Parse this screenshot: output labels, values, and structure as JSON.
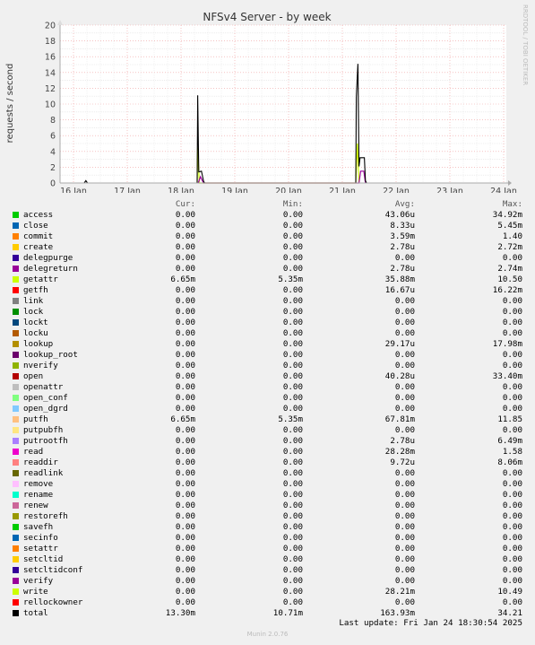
{
  "chart_data": {
    "type": "line",
    "title": "NFSv4 Server - by week",
    "ylabel": "requests / second",
    "watermark": "RRDTOOL / TOBI OETIKER",
    "ylim": [
      0,
      20
    ],
    "yticks": [
      "0",
      "2",
      "4",
      "6",
      "8",
      "10",
      "12",
      "14",
      "16",
      "18",
      "20"
    ],
    "xticks": [
      "16 Jan",
      "17 Jan",
      "18 Jan",
      "19 Jan",
      "20 Jan",
      "21 Jan",
      "22 Jan",
      "23 Jan",
      "24 Jan"
    ],
    "x_day_range": [
      15.75,
      24.05
    ],
    "series_total": {
      "name": "total",
      "points": [
        [
          16.2,
          0
        ],
        [
          16.23,
          0.3
        ],
        [
          16.26,
          0
        ],
        [
          18.3,
          0
        ],
        [
          18.31,
          11.1
        ],
        [
          18.33,
          1.4
        ],
        [
          18.38,
          1.5
        ],
        [
          18.42,
          0.2
        ],
        [
          18.44,
          0
        ],
        [
          21.25,
          0
        ],
        [
          21.26,
          10.9
        ],
        [
          21.29,
          15.1
        ],
        [
          21.31,
          2.1
        ],
        [
          21.33,
          3.2
        ],
        [
          21.41,
          3.2
        ],
        [
          21.43,
          0.3
        ],
        [
          21.45,
          0
        ]
      ]
    },
    "series_getattr": {
      "name": "getattr",
      "points": [
        [
          18.3,
          0
        ],
        [
          18.31,
          4.5
        ],
        [
          18.34,
          0
        ],
        [
          21.25,
          0
        ],
        [
          21.28,
          5.0
        ],
        [
          21.31,
          0
        ]
      ]
    },
    "series_putfh": {
      "name": "putfh",
      "points": [
        [
          18.32,
          0
        ],
        [
          18.36,
          0.8
        ],
        [
          18.42,
          0
        ],
        [
          21.31,
          0
        ],
        [
          21.34,
          1.5
        ],
        [
          21.4,
          1.5
        ],
        [
          21.43,
          0
        ]
      ]
    }
  },
  "legend": {
    "headers": {
      "cur": "Cur:",
      "min": "Min:",
      "avg": "Avg:",
      "max": "Max:"
    },
    "rows": [
      {
        "name": "access",
        "color": "#00cc00",
        "cur": "0.00",
        "min": "0.00",
        "avg": "43.06u",
        "max": "34.92m"
      },
      {
        "name": "close",
        "color": "#0066b3",
        "cur": "0.00",
        "min": "0.00",
        "avg": "8.33u",
        "max": "5.45m"
      },
      {
        "name": "commit",
        "color": "#ff8000",
        "cur": "0.00",
        "min": "0.00",
        "avg": "3.59m",
        "max": "1.40"
      },
      {
        "name": "create",
        "color": "#ffcc00",
        "cur": "0.00",
        "min": "0.00",
        "avg": "2.78u",
        "max": "2.72m"
      },
      {
        "name": "delegpurge",
        "color": "#330099",
        "cur": "0.00",
        "min": "0.00",
        "avg": "0.00",
        "max": "0.00"
      },
      {
        "name": "delegreturn",
        "color": "#990099",
        "cur": "0.00",
        "min": "0.00",
        "avg": "2.78u",
        "max": "2.74m"
      },
      {
        "name": "getattr",
        "color": "#ccff00",
        "cur": "6.65m",
        "min": "5.35m",
        "avg": "35.88m",
        "max": "10.50"
      },
      {
        "name": "getfh",
        "color": "#ff0000",
        "cur": "0.00",
        "min": "0.00",
        "avg": "16.67u",
        "max": "16.22m"
      },
      {
        "name": "link",
        "color": "#808080",
        "cur": "0.00",
        "min": "0.00",
        "avg": "0.00",
        "max": "0.00"
      },
      {
        "name": "lock",
        "color": "#008f00",
        "cur": "0.00",
        "min": "0.00",
        "avg": "0.00",
        "max": "0.00"
      },
      {
        "name": "lockt",
        "color": "#00487d",
        "cur": "0.00",
        "min": "0.00",
        "avg": "0.00",
        "max": "0.00"
      },
      {
        "name": "locku",
        "color": "#b35a00",
        "cur": "0.00",
        "min": "0.00",
        "avg": "0.00",
        "max": "0.00"
      },
      {
        "name": "lookup",
        "color": "#b38f00",
        "cur": "0.00",
        "min": "0.00",
        "avg": "29.17u",
        "max": "17.98m"
      },
      {
        "name": "lookup_root",
        "color": "#6b006b",
        "cur": "0.00",
        "min": "0.00",
        "avg": "0.00",
        "max": "0.00"
      },
      {
        "name": "nverify",
        "color": "#8fb300",
        "cur": "0.00",
        "min": "0.00",
        "avg": "0.00",
        "max": "0.00"
      },
      {
        "name": "open",
        "color": "#b30000",
        "cur": "0.00",
        "min": "0.00",
        "avg": "40.28u",
        "max": "33.40m"
      },
      {
        "name": "openattr",
        "color": "#bebebe",
        "cur": "0.00",
        "min": "0.00",
        "avg": "0.00",
        "max": "0.00"
      },
      {
        "name": "open_conf",
        "color": "#80ff80",
        "cur": "0.00",
        "min": "0.00",
        "avg": "0.00",
        "max": "0.00"
      },
      {
        "name": "open_dgrd",
        "color": "#80c9ff",
        "cur": "0.00",
        "min": "0.00",
        "avg": "0.00",
        "max": "0.00"
      },
      {
        "name": "putfh",
        "color": "#ffc080",
        "cur": "6.65m",
        "min": "5.35m",
        "avg": "67.81m",
        "max": "11.85"
      },
      {
        "name": "putpubfh",
        "color": "#ffe680",
        "cur": "0.00",
        "min": "0.00",
        "avg": "0.00",
        "max": "0.00"
      },
      {
        "name": "putrootfh",
        "color": "#aa80ff",
        "cur": "0.00",
        "min": "0.00",
        "avg": "2.78u",
        "max": "6.49m"
      },
      {
        "name": "read",
        "color": "#ee00cc",
        "cur": "0.00",
        "min": "0.00",
        "avg": "28.28m",
        "max": "1.58"
      },
      {
        "name": "readdir",
        "color": "#ff8080",
        "cur": "0.00",
        "min": "0.00",
        "avg": "9.72u",
        "max": "8.06m"
      },
      {
        "name": "readlink",
        "color": "#666600",
        "cur": "0.00",
        "min": "0.00",
        "avg": "0.00",
        "max": "0.00"
      },
      {
        "name": "remove",
        "color": "#ffbfff",
        "cur": "0.00",
        "min": "0.00",
        "avg": "0.00",
        "max": "0.00"
      },
      {
        "name": "rename",
        "color": "#00ffcc",
        "cur": "0.00",
        "min": "0.00",
        "avg": "0.00",
        "max": "0.00"
      },
      {
        "name": "renew",
        "color": "#cc6699",
        "cur": "0.00",
        "min": "0.00",
        "avg": "0.00",
        "max": "0.00"
      },
      {
        "name": "restorefh",
        "color": "#999900",
        "cur": "0.00",
        "min": "0.00",
        "avg": "0.00",
        "max": "0.00"
      },
      {
        "name": "savefh",
        "color": "#00cc00",
        "cur": "0.00",
        "min": "0.00",
        "avg": "0.00",
        "max": "0.00"
      },
      {
        "name": "secinfo",
        "color": "#0066b3",
        "cur": "0.00",
        "min": "0.00",
        "avg": "0.00",
        "max": "0.00"
      },
      {
        "name": "setattr",
        "color": "#ff8000",
        "cur": "0.00",
        "min": "0.00",
        "avg": "0.00",
        "max": "0.00"
      },
      {
        "name": "setcltid",
        "color": "#ffcc00",
        "cur": "0.00",
        "min": "0.00",
        "avg": "0.00",
        "max": "0.00"
      },
      {
        "name": "setcltidconf",
        "color": "#330099",
        "cur": "0.00",
        "min": "0.00",
        "avg": "0.00",
        "max": "0.00"
      },
      {
        "name": "verify",
        "color": "#990099",
        "cur": "0.00",
        "min": "0.00",
        "avg": "0.00",
        "max": "0.00"
      },
      {
        "name": "write",
        "color": "#ccff00",
        "cur": "0.00",
        "min": "0.00",
        "avg": "28.21m",
        "max": "10.49"
      },
      {
        "name": "rellockowner",
        "color": "#ff0000",
        "cur": "0.00",
        "min": "0.00",
        "avg": "0.00",
        "max": "0.00"
      },
      {
        "name": "total",
        "color": "#000000",
        "cur": "13.30m",
        "min": "10.71m",
        "avg": "163.93m",
        "max": "34.21"
      }
    ]
  },
  "footer": {
    "last_update": "Last update: Fri Jan 24 18:30:54 2025",
    "version": "Munin 2.0.76"
  }
}
